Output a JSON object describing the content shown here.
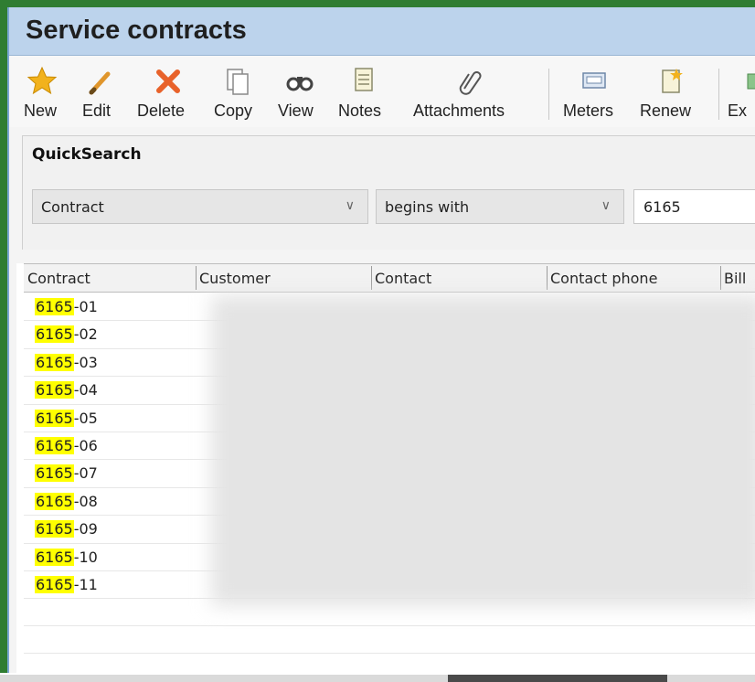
{
  "window": {
    "title": "Service contracts"
  },
  "toolbar": {
    "new": "New",
    "edit": "Edit",
    "delete": "Delete",
    "copy": "Copy",
    "view": "View",
    "notes": "Notes",
    "attachments": "Attachments",
    "meters": "Meters",
    "renew": "Renew",
    "export_partial": "Ex"
  },
  "quicksearch": {
    "title": "QuickSearch",
    "field": "Contract",
    "operator": "begins with",
    "value": "6165"
  },
  "grid": {
    "columns": [
      "Contract",
      "Customer",
      "Contact",
      "Contact phone",
      "Bill"
    ],
    "highlight": "6165",
    "rows": [
      {
        "prefix": "6165",
        "suffix": "-01"
      },
      {
        "prefix": "6165",
        "suffix": "-02"
      },
      {
        "prefix": "6165",
        "suffix": "-03"
      },
      {
        "prefix": "6165",
        "suffix": "-04"
      },
      {
        "prefix": "6165",
        "suffix": "-05"
      },
      {
        "prefix": "6165",
        "suffix": "-06"
      },
      {
        "prefix": "6165",
        "suffix": "-07"
      },
      {
        "prefix": "6165",
        "suffix": "-08"
      },
      {
        "prefix": "6165",
        "suffix": "-09"
      },
      {
        "prefix": "6165",
        "suffix": "-10"
      },
      {
        "prefix": "6165",
        "suffix": "-11"
      }
    ]
  },
  "colors": {
    "highlight": "#ffff00",
    "title_bar": "#bcd3ec",
    "frame": "#2f7d32"
  }
}
